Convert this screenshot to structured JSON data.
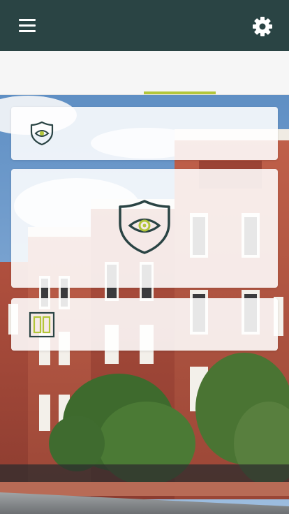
{
  "header": {
    "menu_icon": "hamburger-menu-icon",
    "settings_icon": "gear-icon"
  },
  "tabs": {
    "count": 4,
    "active_index": 2,
    "indicator_color": "#b3c63a"
  },
  "cards": [
    {
      "name": "security-card-small",
      "icon": "shield-eye-icon"
    },
    {
      "name": "security-card-large",
      "icon": "shield-eye-icon"
    },
    {
      "name": "panel-card",
      "icon": "dual-panel-icon"
    }
  ],
  "colors": {
    "header_bg": "#2a4444",
    "accent": "#b3c63a",
    "icon_stroke": "#2a4444"
  }
}
